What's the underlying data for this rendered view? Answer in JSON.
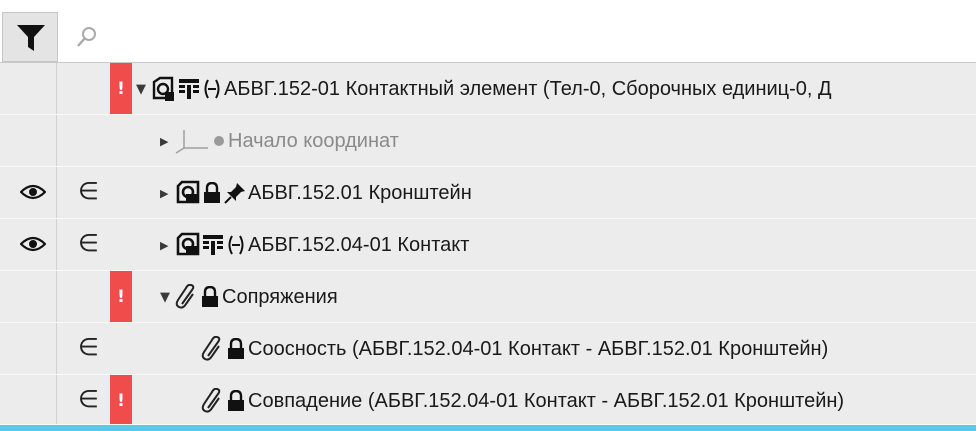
{
  "filter_bar": {
    "filter_icon": "funnel-icon",
    "search_icon": "search-icon",
    "search_value": ""
  },
  "tree": {
    "rows": [
      {
        "visible": false,
        "member_icon": "",
        "error": "!",
        "expanded": true,
        "icons": [
          "assembly-icon",
          "config-table-icon",
          "minus-circle-icon"
        ],
        "label": "АБВГ.152-01 Контактный элемент (Тел-0, Сборочных единиц-0, Д"
      },
      {
        "visible": false,
        "member_icon": "",
        "error": "",
        "expanded": false,
        "icons": [
          "axes-icon",
          "dot-icon"
        ],
        "label": "Начало координат"
      },
      {
        "visible": true,
        "member_icon": "∈",
        "error": "",
        "expanded": false,
        "icons": [
          "part-icon",
          "lock-icon",
          "pin-icon"
        ],
        "label": "АБВГ.152.01 Кронштейн"
      },
      {
        "visible": true,
        "member_icon": "∈",
        "error": "",
        "expanded": false,
        "icons": [
          "part-icon",
          "config-table-icon",
          "minus-circle-icon"
        ],
        "label": "АБВГ.152.04-01 Контакт"
      },
      {
        "visible": false,
        "member_icon": "",
        "error": "!",
        "expanded": true,
        "icons": [
          "paperclip-icon",
          "lock-icon"
        ],
        "label": "Сопряжения"
      },
      {
        "visible": false,
        "member_icon": "∈",
        "error": "",
        "expanded": null,
        "icons": [
          "paperclip-icon",
          "lock-icon"
        ],
        "label": "Соосность (АБВГ.152.04-01 Контакт  -  АБВГ.152.01 Кронштейн)"
      },
      {
        "visible": false,
        "member_icon": "∈",
        "error": "!",
        "expanded": null,
        "icons": [
          "paperclip-icon",
          "lock-icon"
        ],
        "label": "Совпадение (АБВГ.152.04-01 Контакт  -  АБВГ.152.01 Кронштейн)"
      }
    ]
  },
  "colors": {
    "row_background": "#ececec",
    "error_badge": "#f04c4c",
    "selection_line": "#5bc9e6",
    "filter_button": "#e4e4e4"
  }
}
